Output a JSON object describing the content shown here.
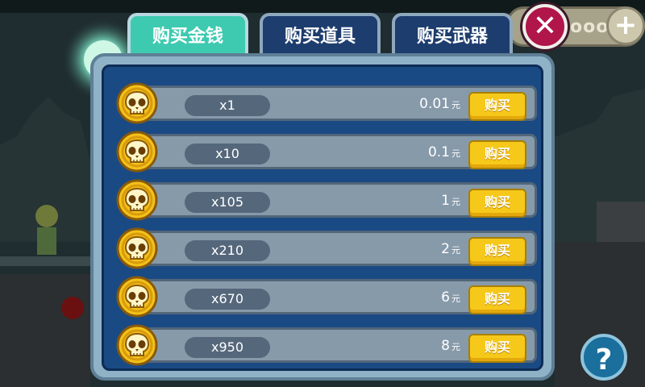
{
  "tabs": [
    {
      "label": "购买金钱",
      "active": true
    },
    {
      "label": "购买道具",
      "active": false
    },
    {
      "label": "购买武器",
      "active": false
    }
  ],
  "header": {
    "coin_dots": "ooo",
    "plus_label": "+",
    "close_label": "✕"
  },
  "items": [
    {
      "qty": "x1",
      "price": "0.01",
      "unit": "元",
      "buy": "购买"
    },
    {
      "qty": "x10",
      "price": "0.1",
      "unit": "元",
      "buy": "购买"
    },
    {
      "qty": "x105",
      "price": "1",
      "unit": "元",
      "buy": "购买"
    },
    {
      "qty": "x210",
      "price": "2",
      "unit": "元",
      "buy": "购买"
    },
    {
      "qty": "x670",
      "price": "6",
      "unit": "元",
      "buy": "购买"
    },
    {
      "qty": "x950",
      "price": "8",
      "unit": "元",
      "buy": "购买"
    }
  ],
  "help_label": "?",
  "colors": {
    "tab_active": "#3ecab0",
    "tab_inactive": "#1d3d6e",
    "buy_button": "#f6c81a",
    "coin": "#f2c21b",
    "close": "#b0164a"
  }
}
